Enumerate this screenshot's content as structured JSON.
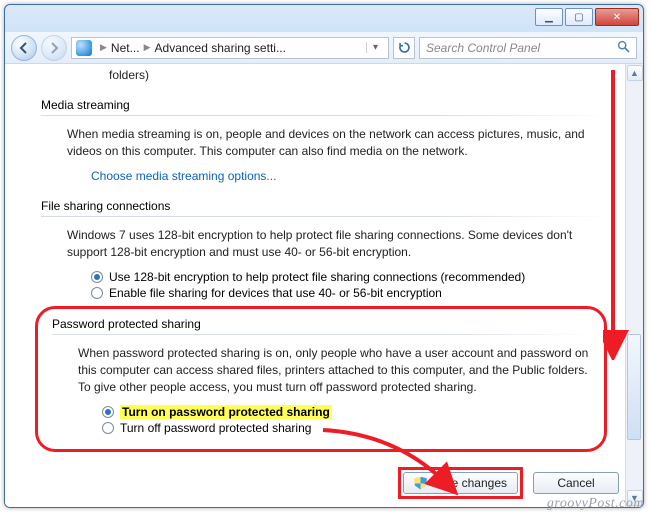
{
  "titlebar": {
    "min": "▁",
    "max": "▢",
    "close": "✕"
  },
  "nav": {
    "crumb1": "Net...",
    "crumb2": "Advanced sharing setti...",
    "search_placeholder": "Search Control Panel"
  },
  "remnant": "folders)",
  "section1": {
    "title": "Media streaming",
    "body": "When media streaming is on, people and devices on the network can access pictures, music, and videos on this computer. This computer can also find media on the network.",
    "link": "Choose media streaming options..."
  },
  "section2": {
    "title": "File sharing connections",
    "body": "Windows 7 uses 128-bit encryption to help protect file sharing connections. Some devices don't support 128-bit encryption and must use 40- or 56-bit encryption.",
    "opt1": "Use 128-bit encryption to help protect file sharing connections (recommended)",
    "opt2": "Enable file sharing for devices that use 40- or 56-bit encryption"
  },
  "section3": {
    "title": "Password protected sharing",
    "body": "When password protected sharing is on, only people who have a user account and password on this computer can access shared files, printers attached to this computer, and the Public folders. To give other people access, you must turn off password protected sharing.",
    "opt1": "Turn on password protected sharing",
    "opt2": "Turn off password protected sharing"
  },
  "footer": {
    "save": "Save changes",
    "cancel": "Cancel"
  },
  "watermark": "groovyPost.com"
}
